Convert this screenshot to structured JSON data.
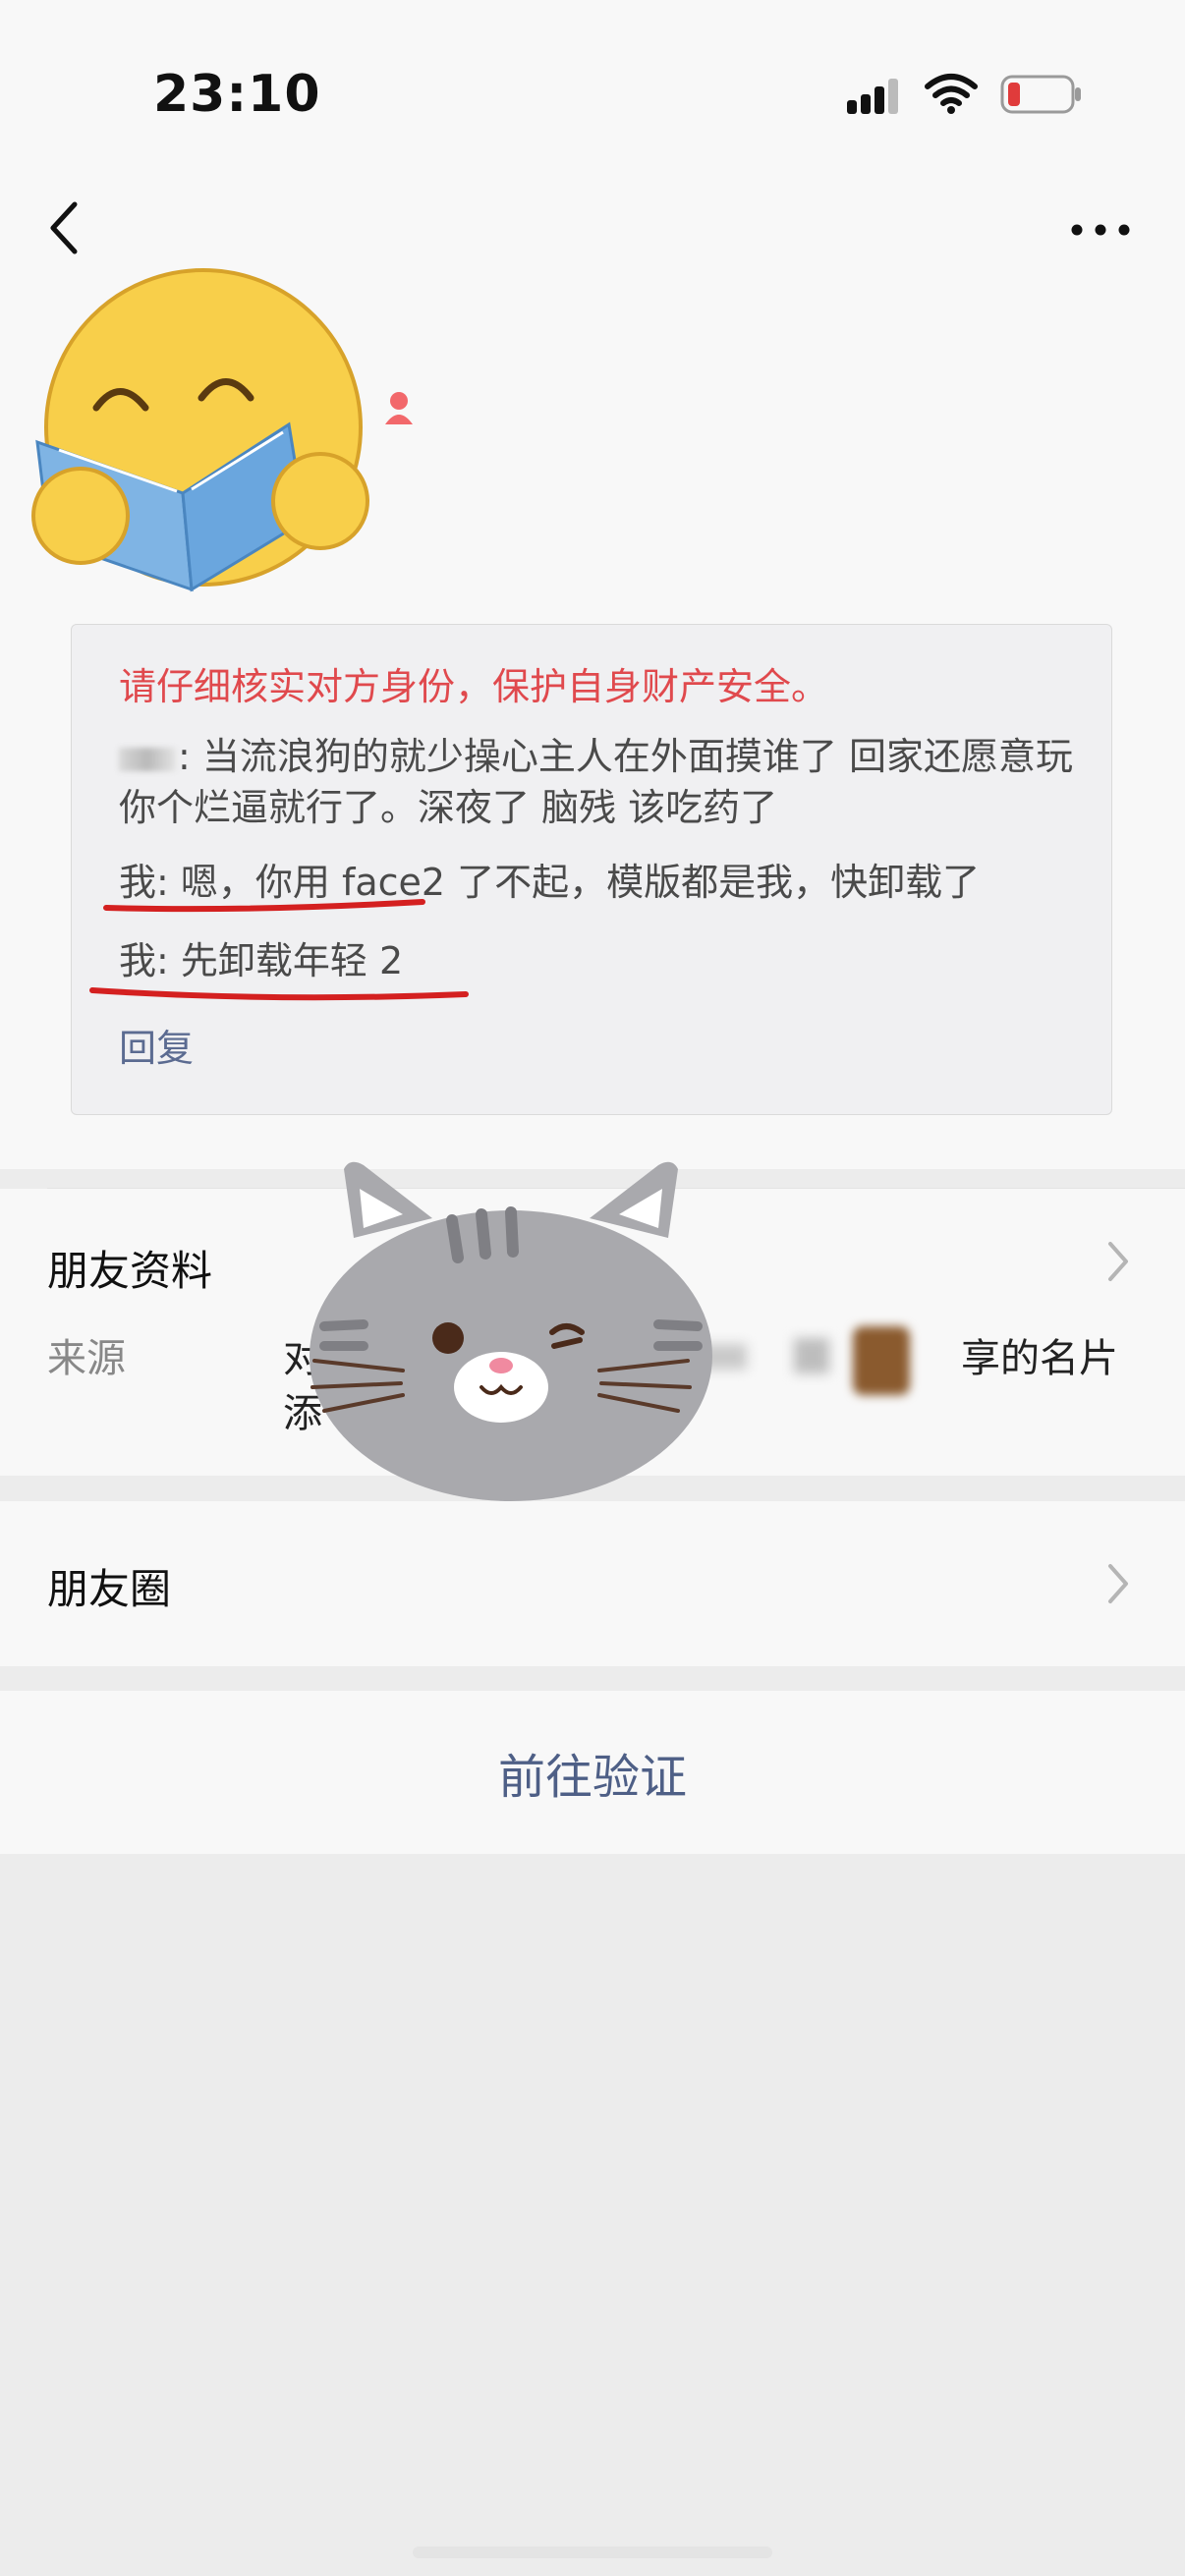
{
  "status_bar": {
    "time": "23:10"
  },
  "nav": {
    "back_icon": "chevron-left-icon",
    "more_icon": "more-dots-icon"
  },
  "message_box": {
    "warning": "请仔细核实对方身份，保护自身财产安全。",
    "message_1": ": 当流浪狗的就少操心主人在外面摸谁了 回家还愿意玩你个烂逼就行了。深夜了 脑残 该吃药了",
    "message_2": "我: 嗯，你用 face2 了不起，模版都是我，快卸载了",
    "message_3": "我: 先卸载年轻 2",
    "reply": "回复"
  },
  "friend_info": {
    "title": "朋友资料",
    "source_label": "来源",
    "source_value_line1": "对",
    "source_value_line2": "添",
    "source_value_end": "享的名片"
  },
  "moments": {
    "title": "朋友圈"
  },
  "actions": {
    "verify": "前往验证"
  },
  "colors": {
    "warning": "#e0494d",
    "link": "#5b6b91",
    "accent_button": "#4e5f86",
    "annotation_red": "#d42020"
  }
}
